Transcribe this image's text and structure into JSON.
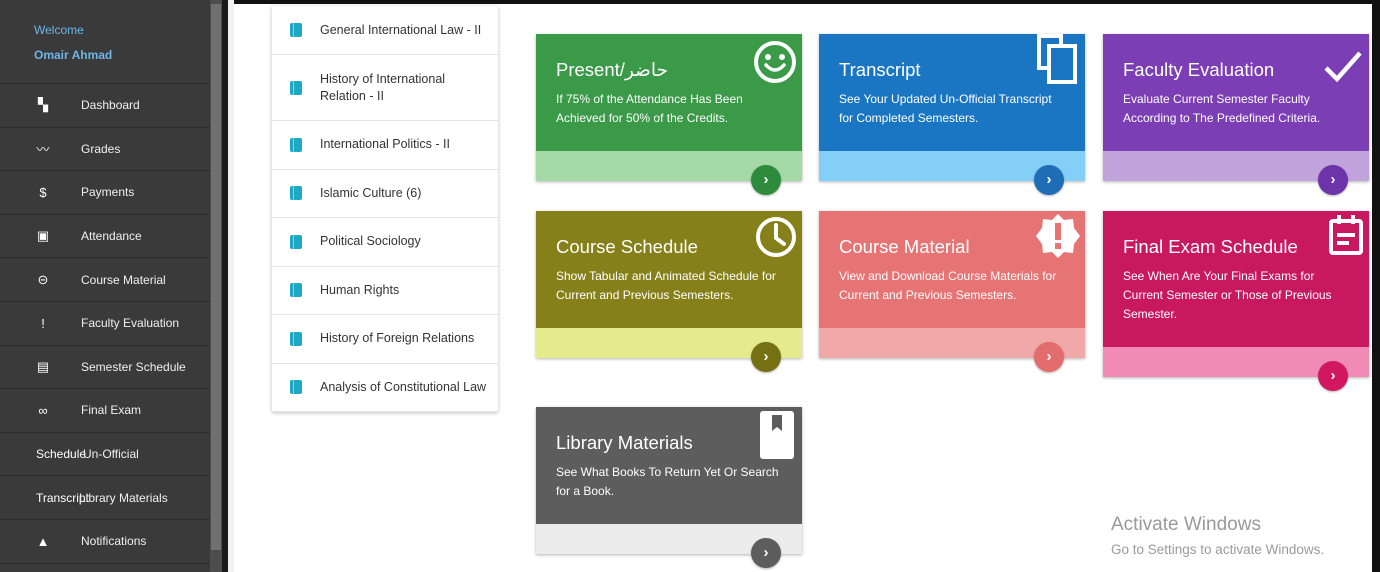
{
  "user": {
    "welcome": "Welcome",
    "name": "Omair Ahmad"
  },
  "nav": [
    {
      "icon": "dashboard-icon",
      "glyph": "▚",
      "label": "Dashboard"
    },
    {
      "icon": "grades-icon",
      "glyph": "〰",
      "label": "Grades"
    },
    {
      "icon": "dollar-icon",
      "glyph": "$",
      "label": "Payments"
    },
    {
      "icon": "calendar-icon",
      "glyph": "▣",
      "label": "Attendance"
    },
    {
      "icon": "link-icon",
      "glyph": "⊝",
      "label": "Course Material"
    },
    {
      "icon": "feedback-icon",
      "glyph": "!",
      "label": "Faculty Evaluation"
    },
    {
      "icon": "schedule-icon",
      "glyph": "▤",
      "label": "Semester Schedule"
    },
    {
      "icon": "infinity-icon",
      "glyph": "∞",
      "label": "Final Exam"
    },
    {
      "icon": "graduation-cap-icon",
      "glyph": "",
      "ghost": "Schedule",
      "label": "Un-Official"
    },
    {
      "icon": "transcript-icon",
      "glyph": "",
      "ghost": "Transcript",
      "label": "Library Materials"
    },
    {
      "icon": "bell-icon",
      "glyph": "▲",
      "label": "Notifications"
    }
  ],
  "courses": [
    "General International Law - II",
    "History of International Relation - II",
    "International Politics - II",
    "Islamic Culture (6)",
    "Political Sociology",
    "Human Rights",
    "History of Foreign Relations",
    "Analysis of Constitutional Law"
  ],
  "cards": [
    {
      "title": "Present/حاضر",
      "desc": "If 75% of the Attendance Has Been Achieved for 50% of the Credits.",
      "icon": "smiley-icon",
      "color_top": "#3a9a48",
      "color_bottom": "#a6d9a8",
      "color_btn": "#2e8b3c"
    },
    {
      "title": "Transcript",
      "desc": "See Your Updated Un-Official Transcript for Completed Semesters.",
      "icon": "copy-icon",
      "color_top": "#1a76c2",
      "color_bottom": "#84cff7",
      "color_btn": "#1f6db5"
    },
    {
      "title": "Faculty Evaluation",
      "desc": "Evaluate Current Semester Faculty According to The Predefined Criteria.",
      "icon": "checkmark-icon",
      "color_top": "#7b3eb5",
      "color_bottom": "#c2a4dc",
      "color_btn": "#6d33a8"
    },
    {
      "title": "Course Schedule",
      "desc": "Show Tabular and Animated Schedule for Current and Previous Semesters.",
      "icon": "clock-icon",
      "color_top": "#858019",
      "color_bottom": "#e5ea8c",
      "color_btn": "#757012"
    },
    {
      "title": "Course Material",
      "desc": "View and Download Course Materials for Current and Previous Semesters.",
      "icon": "alert-badge-icon",
      "color_top": "#e77474",
      "color_bottom": "#f0a8a8",
      "color_btn": "#e36c6c"
    },
    {
      "title": "Final Exam Schedule",
      "desc": "See When Are Your Final Exams for Current Semester or Those of Previous Semester.",
      "icon": "calendar-note-icon",
      "color_top": "#c8185f",
      "color_bottom": "#f18bb5",
      "color_btn": "#d1175f"
    },
    {
      "title": "Library Materials",
      "desc": "See What Books To Return Yet Or Search for a Book.",
      "icon": "bookmark-icon",
      "color_top": "#5d5d5d",
      "color_bottom": "#ececec",
      "color_btn": "#5d5d5d"
    }
  ],
  "go_glyph": "›",
  "watermark": {
    "line1": "Activate Windows",
    "line2": "Go to Settings to activate Windows."
  }
}
